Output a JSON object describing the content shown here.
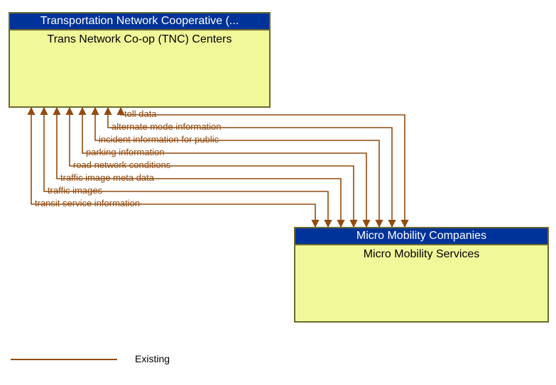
{
  "top_box": {
    "header": "Transportation Network Cooperative (...",
    "body": "Trans Network Co-op (TNC) Centers"
  },
  "bottom_box": {
    "header": "Micro Mobility Companies",
    "body": "Micro Mobility Services"
  },
  "flows": [
    {
      "label": "toll data"
    },
    {
      "label": "alternate mode information"
    },
    {
      "label": "incident information for public"
    },
    {
      "label": "parking information"
    },
    {
      "label": "road network conditions"
    },
    {
      "label": "traffic image meta data"
    },
    {
      "label": "traffic images"
    },
    {
      "label": "transit service information"
    }
  ],
  "legend": {
    "label": "Existing"
  }
}
